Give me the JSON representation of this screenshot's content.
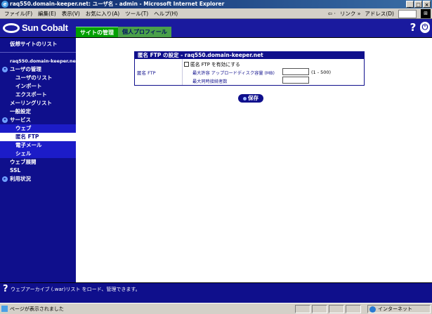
{
  "window": {
    "title": "raq550.domain-keeper.net: ユーザ名 - admin - Microsoft Internet Explorer",
    "controls": [
      "_",
      "□",
      "×"
    ]
  },
  "menubar": {
    "items": [
      "ファイル(F)",
      "編集(E)",
      "表示(V)",
      "お気に入り(A)",
      "ツール(T)",
      "ヘルプ(H)"
    ],
    "back": "⇦ ·",
    "links_label": "リンク »",
    "address_label": "アドレス(D)"
  },
  "header": {
    "brand": "Sun Cobalt",
    "tabs": [
      "サイトの管理",
      "個人プロフィール"
    ],
    "help": "?",
    "exit": "⏻"
  },
  "sidebar": {
    "virtual_sites": "仮想サイトのリスト",
    "host": "raq550.domain-keeper.net",
    "user_mgmt": "ユーザの管理",
    "user_list": "ユーザのリスト",
    "import": "インポート",
    "export": "エクスポート",
    "mailing_list": "メーリングリスト",
    "general": "一般設定",
    "services": "サービス",
    "web": "ウェブ",
    "anon_ftp": "匿名 FTP",
    "email": "電子メール",
    "shell": "シェル",
    "web_deploy": "ウェブ展開",
    "ssl": "SSL",
    "usage": "利用状況"
  },
  "panel": {
    "title": "匿名 FTP の設定 - raq550.domain-keeper.net",
    "label": "匿名 FTP",
    "enable_label": "匿名 FTP を有効にする",
    "enable_checked": false,
    "quota_label": "最大許容 アップロードディスク容量 (MB)",
    "quota_value": "",
    "quota_range": "(1 - 500)",
    "max_conn_label": "最大同時接続者数",
    "max_conn_value": ""
  },
  "save_button": "保存",
  "helpbar": {
    "icon": "?",
    "text": "ウェブアーカイブ (.war)リスト をロード、管理できます。"
  },
  "statusbar": {
    "text": "ページが表示されました",
    "zone": "インターネット"
  },
  "colors": {
    "navy": "#0f0f8c",
    "tab_active": "#00a000",
    "tab_inactive": "#4aa04a"
  }
}
